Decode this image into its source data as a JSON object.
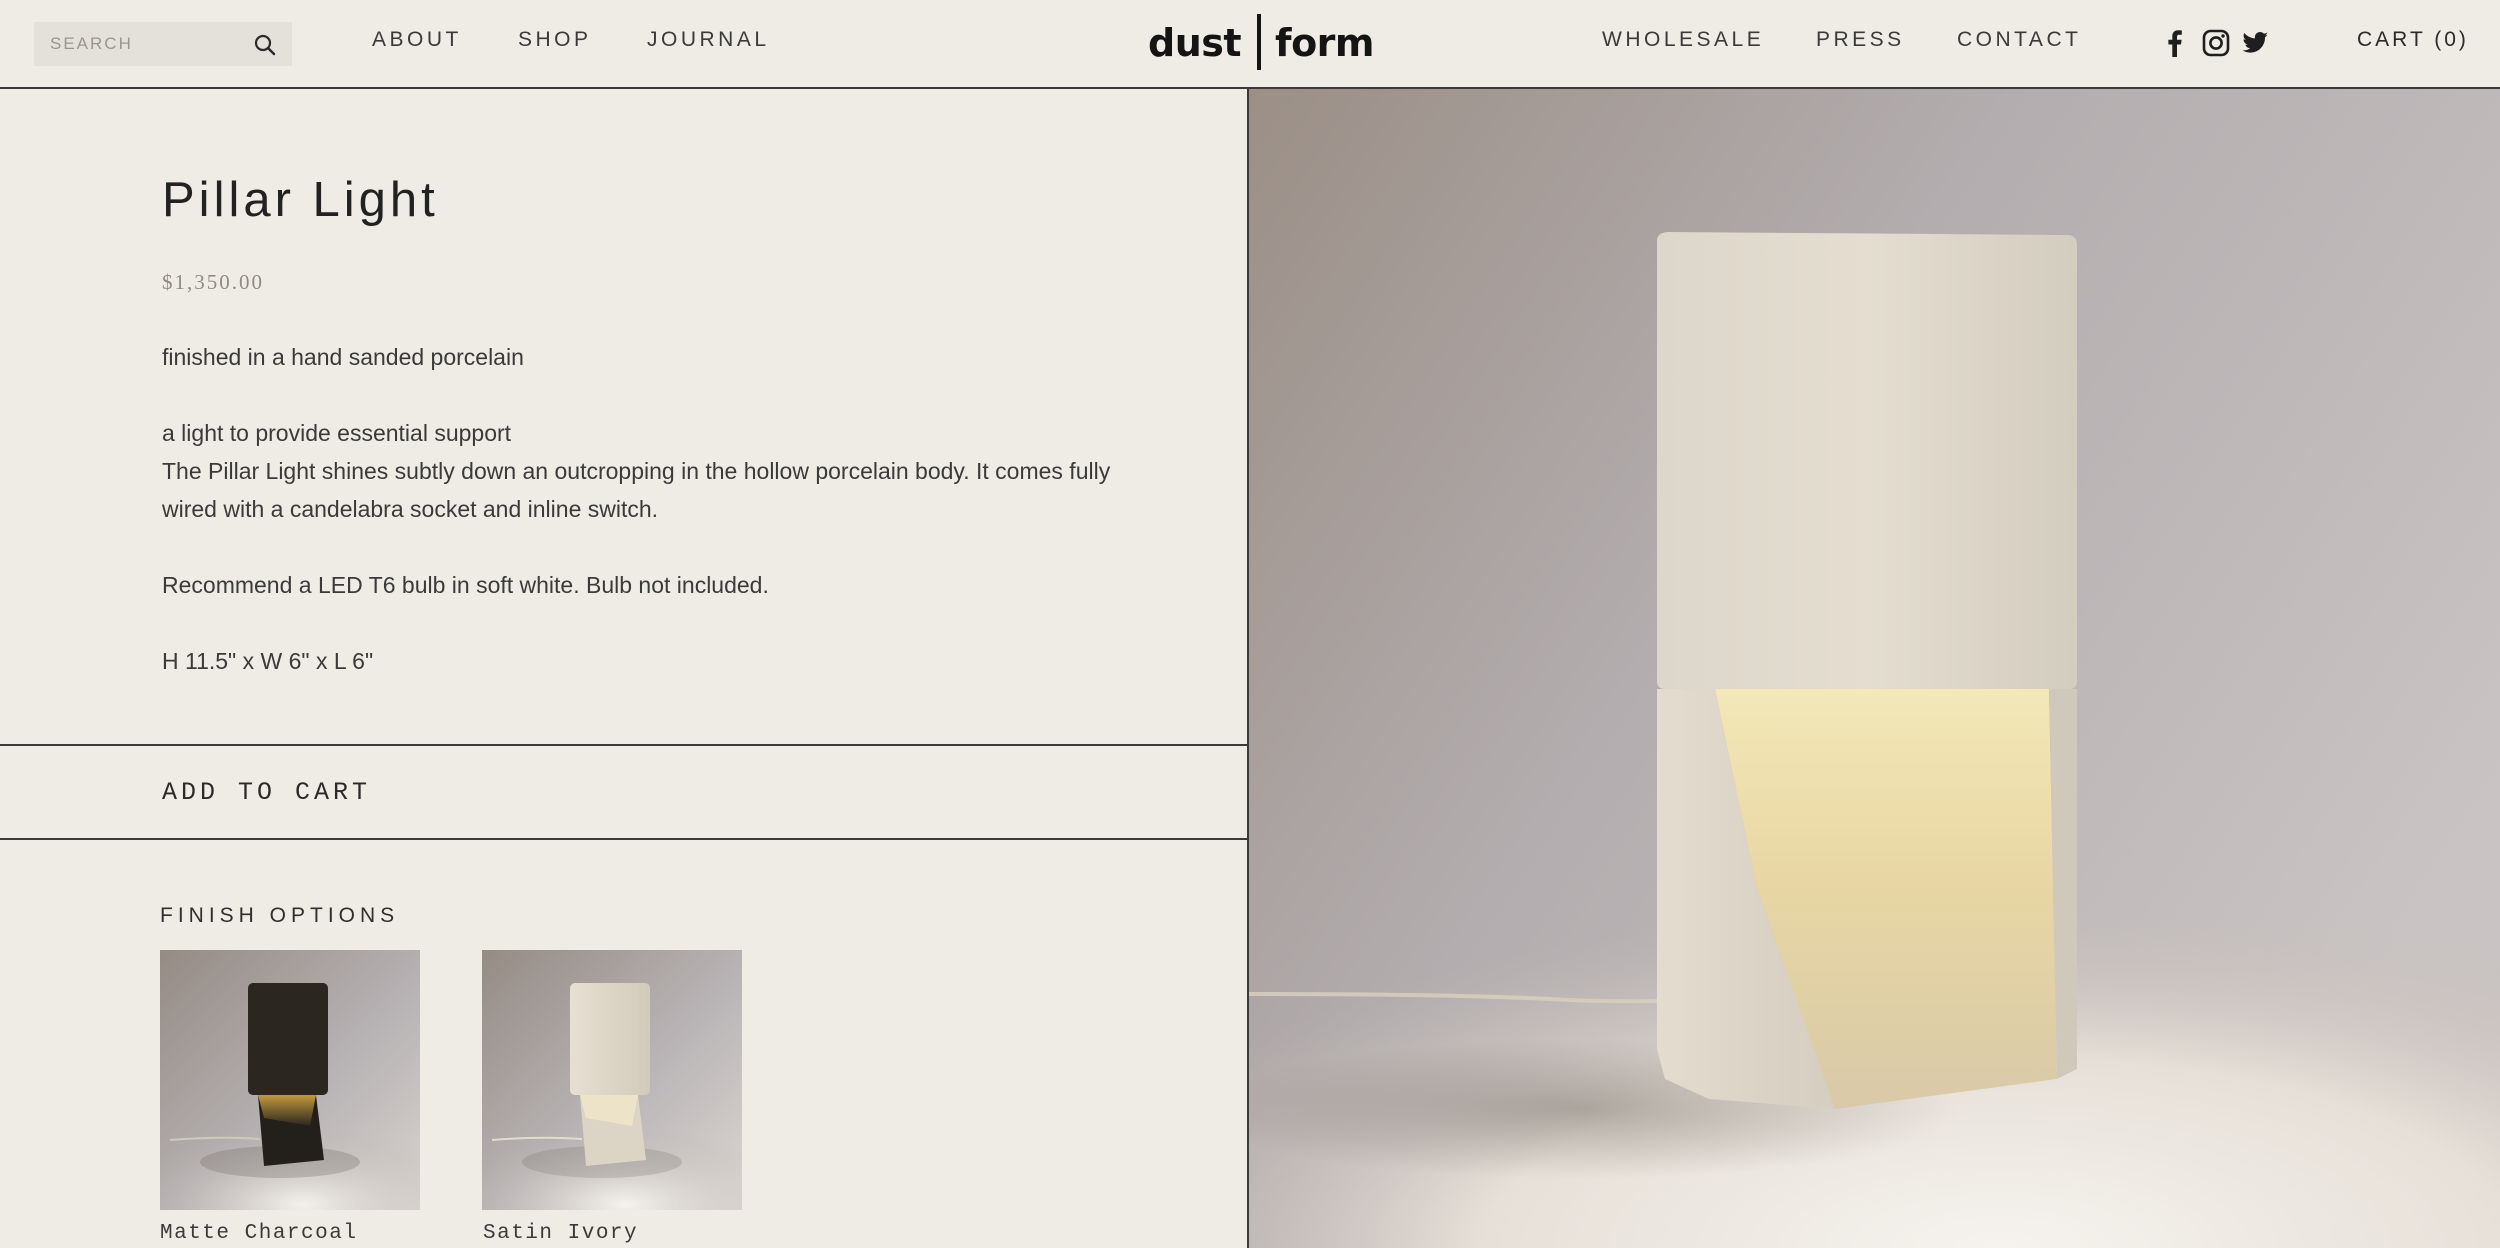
{
  "header": {
    "search": {
      "placeholder": "SEARCH",
      "value": ""
    },
    "nav_left": [
      "ABOUT",
      "SHOP",
      "JOURNAL"
    ],
    "logo": {
      "left": "dust",
      "right": "form"
    },
    "nav_right": [
      "WHOLESALE",
      "PRESS",
      "CONTACT"
    ],
    "social_icons": [
      "facebook-icon",
      "instagram-icon",
      "twitter-icon"
    ],
    "cart_label": "CART (0)"
  },
  "product": {
    "title": "Pillar Light",
    "price": "$1,350.00",
    "finish_line": "finished in a hand sanded porcelain",
    "tagline": "a light to provide essential support",
    "body": "The Pillar Light shines subtly down an outcropping in the hollow porcelain body. It comes fully wired with a candelabra socket and inline switch.",
    "bulb_note": "Recommend a LED T6 bulb in soft white. Bulb not included.",
    "dimensions": "H 11.5\" x W 6\" x L 6\"",
    "add_to_cart_label": "ADD TO CART"
  },
  "finish_options": {
    "heading": "FINISH OPTIONS",
    "items": [
      {
        "label": "Matte Charcoal",
        "color": "#2b2620"
      },
      {
        "label": "Satin Ivory",
        "color": "#ebe5d8"
      }
    ]
  },
  "colors": {
    "background": "#efece6",
    "search_bg": "#e4e1db",
    "rule": "#3a3a3a",
    "price": "#8f8b84"
  }
}
